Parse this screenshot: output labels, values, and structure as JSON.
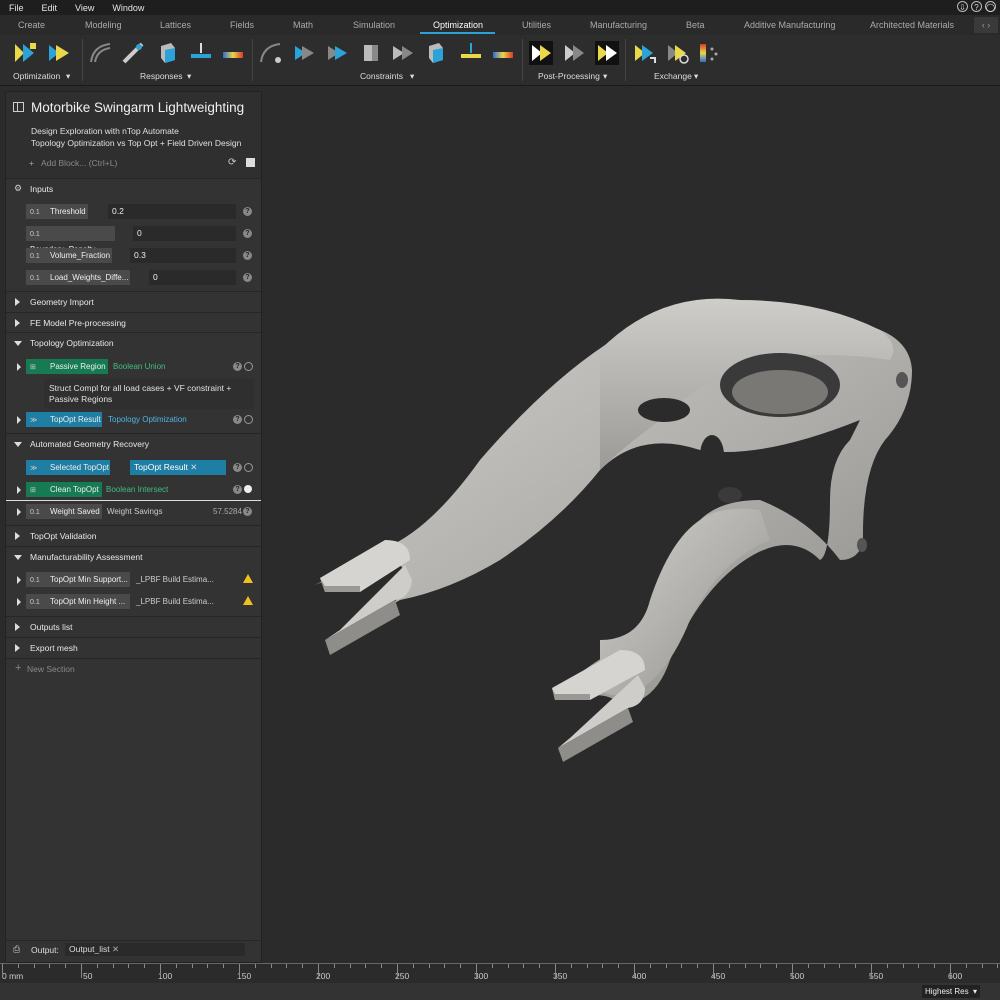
{
  "menu": [
    "File",
    "Edit",
    "View",
    "Window"
  ],
  "menu_right_icons": [
    "download-icon",
    "help-icon",
    "account-icon"
  ],
  "menu_right_glyphs": [
    "⇩",
    "?",
    "◯"
  ],
  "tabs": [
    "Create",
    "Modeling",
    "Lattices",
    "Fields",
    "Math",
    "Simulation",
    "Optimization",
    "Utilities",
    "Manufacturing",
    "Beta",
    "Additive Manufacturing",
    "Architected Materials"
  ],
  "active_tab": "Optimization",
  "ribbon_groups": [
    "Optimization",
    "Responses",
    "Constraints",
    "Post-Processing",
    "Exchange"
  ],
  "notebook": {
    "title": "Motorbike Swingarm Lightweighting",
    "desc1": "Design Exploration with nTop Automate",
    "desc2": "Topology Optimization vs Top Opt + Field Driven Design",
    "add_block": "Add Block... (Ctrl+L)"
  },
  "inputs": {
    "section": "Inputs",
    "rows": [
      {
        "name": "Threshold",
        "value": "0.2"
      },
      {
        "name": "Boundary_Penalty",
        "value": "0"
      },
      {
        "name": "Volume_Fraction",
        "value": "0.3"
      },
      {
        "name": "Load_Weights_Diffe...",
        "value": "0"
      }
    ],
    "type_label": "0.1"
  },
  "sections": {
    "geometry_import": "Geometry Import",
    "fe_model": "FE Model Pre-processing",
    "topology_opt": "Topology Optimization",
    "agr": "Automated Geometry Recovery",
    "topopt_validation": "TopOpt Validation",
    "manufacturability": "Manufacturability Assessment",
    "outputs_list": "Outputs list",
    "export_mesh": "Export mesh",
    "new_section": "New Section"
  },
  "topo_blocks": {
    "passive_region": {
      "name": "Passive Region",
      "type": "Boolean Union"
    },
    "note": "Struct Compl for all load cases + VF constraint + Passive Regions",
    "topopt_result": {
      "name": "TopOpt Result",
      "type": "Topology Optimization"
    }
  },
  "agr_blocks": {
    "selected_topopt": {
      "name": "Selected TopOpt",
      "value": "TopOpt Result"
    },
    "clean_topopt": {
      "name": "Clean TopOpt",
      "type": "Boolean Intersect"
    },
    "weight_saved": {
      "name": "Weight Saved",
      "type": "Weight Savings",
      "value": "57.5284"
    }
  },
  "manuf_blocks": [
    {
      "name": "TopOpt Min Support...",
      "type": "_LPBF Build Estima..."
    },
    {
      "name": "TopOpt Min Height ...",
      "type": "_LPBF Build Estima..."
    }
  ],
  "output": {
    "label": "Output:",
    "value": "Output_list"
  },
  "ruler": {
    "unit_label": "0 mm",
    "labels": [
      "50",
      "100",
      "150",
      "200",
      "250",
      "300",
      "350",
      "400",
      "450",
      "500",
      "550",
      "600"
    ]
  },
  "status": {
    "resolution": "Highest Res"
  },
  "colors": {
    "accent": "#2ba3d8",
    "green_block": "#167a52",
    "blue_block": "#1f7ea3",
    "warning": "#f0c020"
  }
}
